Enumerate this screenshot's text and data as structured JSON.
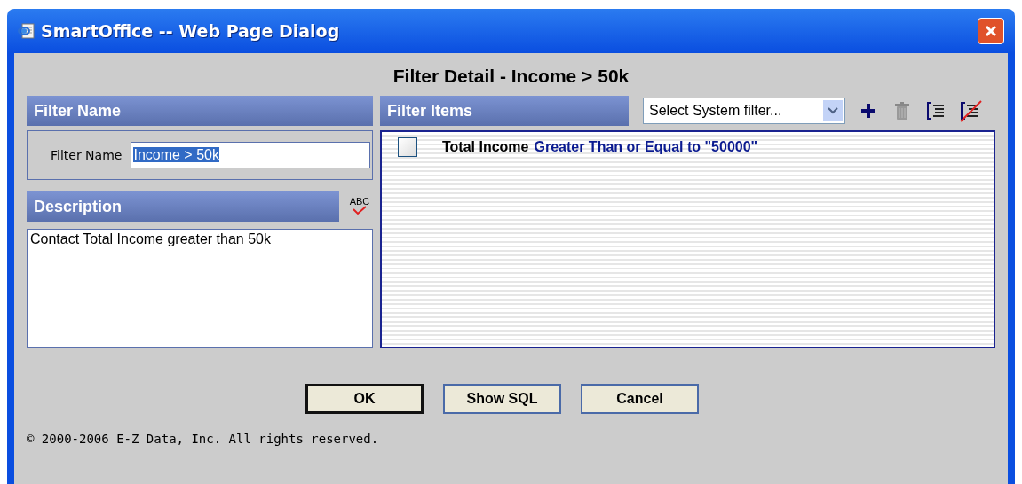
{
  "window": {
    "title": "SmartOffice -- Web Page Dialog"
  },
  "heading": "Filter Detail - Income > 50k",
  "filter_name": {
    "header": "Filter Name",
    "label": "Filter Name",
    "value": "Income > 50k",
    "value_selected": true
  },
  "description": {
    "header": "Description",
    "spellcheck_label": "ABC",
    "value": "Contact Total Income greater than 50k"
  },
  "filter_items": {
    "header": "Filter Items",
    "system_filter": {
      "placeholder": "Select System filter..."
    },
    "items": [
      {
        "field": "Total Income",
        "condition": "Greater Than or Equal to \"50000\"",
        "checked": false
      }
    ]
  },
  "buttons": [
    {
      "label": "OK",
      "default": true
    },
    {
      "label": "Show SQL",
      "default": false
    },
    {
      "label": "Cancel",
      "default": false
    }
  ],
  "copyright": "© 2000-2006 E-Z Data, Inc. All rights reserved."
}
